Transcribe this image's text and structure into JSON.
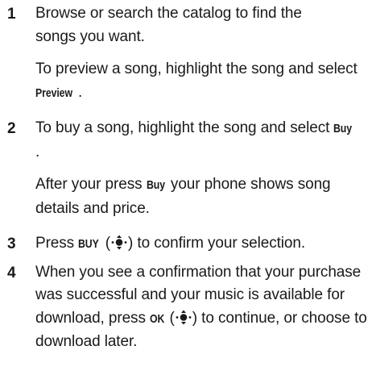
{
  "steps": [
    {
      "number": "1",
      "paragraphs": [
        {
          "parts": [
            {
              "t": "Browse or search the catalog to find the songs you want."
            }
          ]
        },
        {
          "parts": [
            {
              "t": "To preview a song, highlight the song and select "
            },
            {
              "k": "Preview"
            },
            {
              "t": "."
            }
          ]
        }
      ]
    },
    {
      "number": "2",
      "paragraphs": [
        {
          "parts": [
            {
              "t": "To buy a song, highlight the song and select "
            },
            {
              "k": "Buy"
            },
            {
              "t": "."
            }
          ]
        },
        {
          "parts": [
            {
              "t": "After your press "
            },
            {
              "k": "Buy"
            },
            {
              "t": " your phone shows song details and price."
            }
          ]
        }
      ]
    },
    {
      "number": "3",
      "paragraphs": [
        {
          "parts": [
            {
              "t": "Press "
            },
            {
              "k": "BUY"
            },
            {
              "t": " ("
            },
            {
              "icon": "nav-center-select-icon"
            },
            {
              "t": ") to confirm your selection."
            }
          ]
        }
      ]
    },
    {
      "number": "4",
      "paragraphs": [
        {
          "parts": [
            {
              "t": "When you see a confirmation that your purchase was successful and your music is available for download, press "
            },
            {
              "k": "OK"
            },
            {
              "t": " ("
            },
            {
              "icon": "nav-center-select-icon"
            },
            {
              "t": ") to continue, or choose to download later."
            }
          ]
        }
      ]
    }
  ]
}
